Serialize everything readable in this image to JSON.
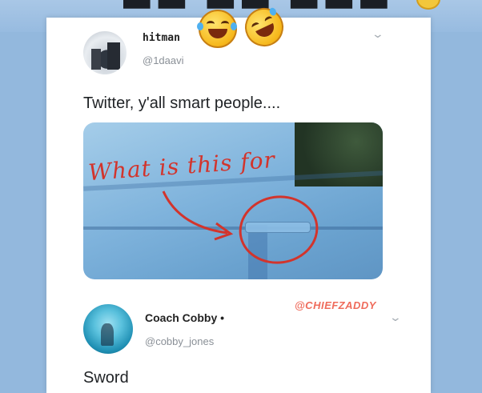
{
  "tweet": {
    "author_name": "hitman",
    "author_handle": "@1daavi",
    "text": "Twitter, y'all smart people....",
    "image_annotation": "What is this for"
  },
  "reply": {
    "author_name": "Coach Cobby •",
    "author_handle": "@cobby_jones",
    "text": "Sword"
  },
  "watermark": "@CHIEFZADDY",
  "icons": {
    "menu_chevron": "chevron-down-icon",
    "laugh_emoji": "face-with-tears-of-joy-icon",
    "rofl_emoji": "rolling-on-floor-laughing-icon"
  },
  "colors": {
    "background": "#93b8dd",
    "card": "#ffffff",
    "annotation_red": "#d2342c",
    "watermark": "#ef6b5b"
  }
}
